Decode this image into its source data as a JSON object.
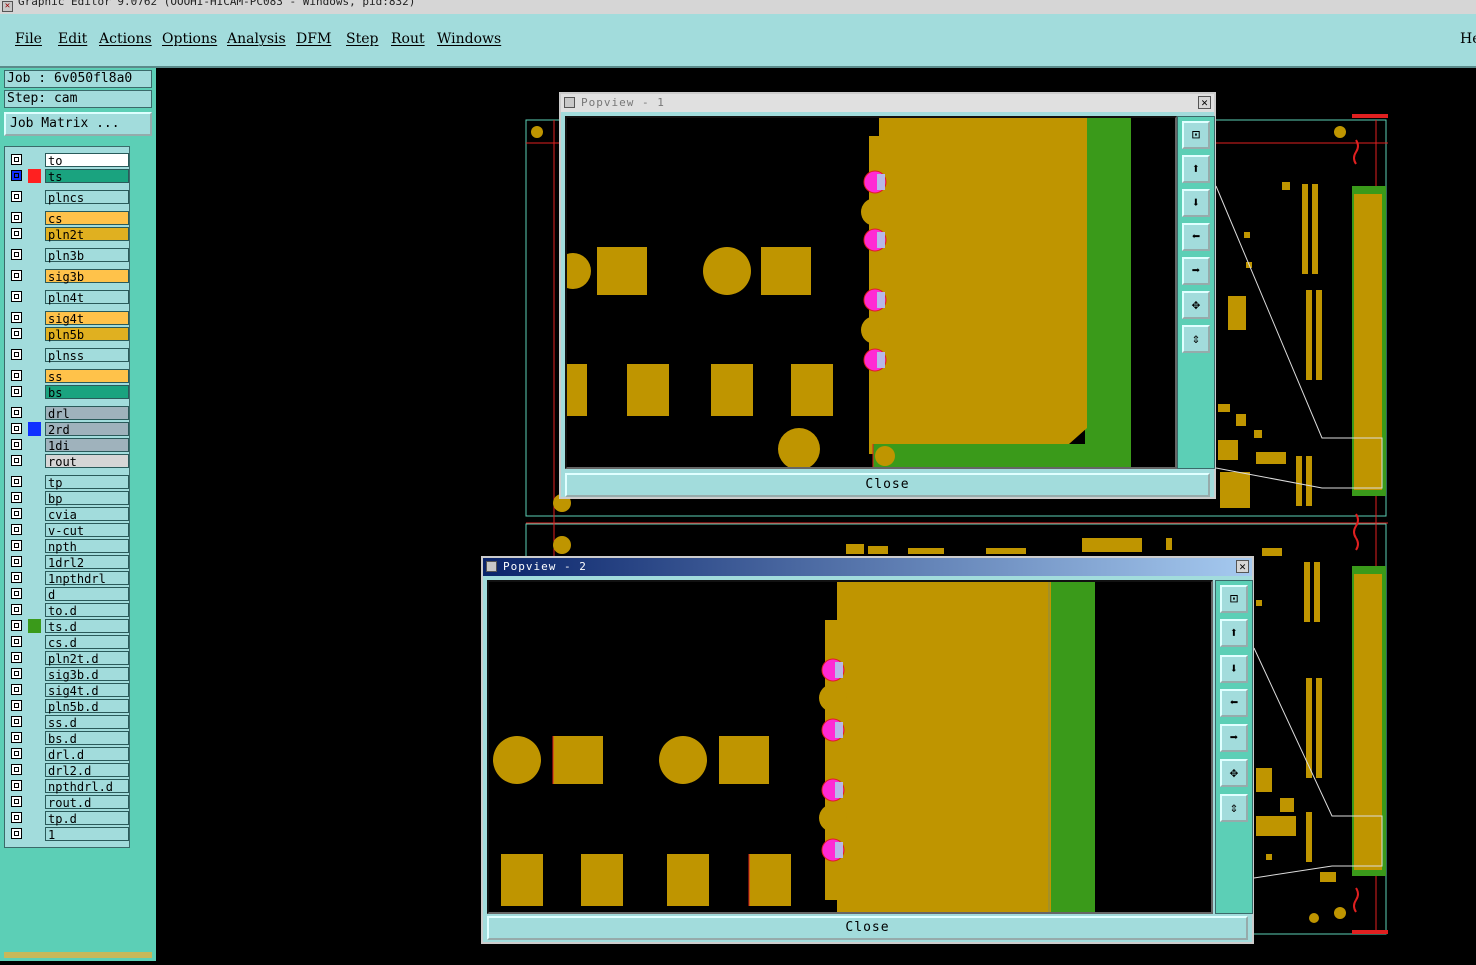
{
  "window": {
    "title": "Graphic Editor 9.0762 (OOOHI-HICAM-PC083 - Windows, pid:832)"
  },
  "menu": {
    "items": [
      "File",
      "Edit",
      "Actions",
      "Options",
      "Analysis",
      "DFM",
      "Step",
      "Rout",
      "Windows"
    ],
    "help": "He"
  },
  "job": {
    "label": "Job : 6v050fl8a0",
    "step": "Step: cam",
    "matrix_button": "Job Matrix ..."
  },
  "layers": [
    {
      "name": "to",
      "color": "#ffffff",
      "swatch": "",
      "active": true
    },
    {
      "name": "ts",
      "color": "#1aa37f",
      "swatch": "#ff2020",
      "active": true
    },
    {
      "name": "plncs",
      "color": "#a2dcdc",
      "swatch": ""
    },
    {
      "name": "cs",
      "color": "#ffc24a",
      "swatch": ""
    },
    {
      "name": "pln2t",
      "color": "#e0b020",
      "swatch": ""
    },
    {
      "name": "pln3b",
      "color": "#a2dcdc",
      "swatch": ""
    },
    {
      "name": "sig3b",
      "color": "#ffc24a",
      "swatch": ""
    },
    {
      "name": "pln4t",
      "color": "#a2dcdc",
      "swatch": ""
    },
    {
      "name": "sig4t",
      "color": "#ffc24a",
      "swatch": ""
    },
    {
      "name": "pln5b",
      "color": "#e0b020",
      "swatch": ""
    },
    {
      "name": "plnss",
      "color": "#a2dcdc",
      "swatch": ""
    },
    {
      "name": "ss",
      "color": "#ffc24a",
      "swatch": ""
    },
    {
      "name": "bs",
      "color": "#1aa37f",
      "swatch": ""
    },
    {
      "name": "drl",
      "color": "#9fb2bc",
      "swatch": ""
    },
    {
      "name": "2rd",
      "color": "#9fb2bc",
      "swatch": "#1030ff"
    },
    {
      "name": "1di",
      "color": "#9fb2bc",
      "swatch": ""
    },
    {
      "name": "rout",
      "color": "#d6d6d6",
      "swatch": ""
    },
    {
      "name": "tp",
      "color": "#a2dcdc",
      "swatch": ""
    },
    {
      "name": "bp",
      "color": "#a2dcdc",
      "swatch": ""
    },
    {
      "name": "cvia",
      "color": "#a2dcdc",
      "swatch": ""
    },
    {
      "name": "v-cut",
      "color": "#a2dcdc",
      "swatch": ""
    },
    {
      "name": "npth",
      "color": "#a2dcdc",
      "swatch": ""
    },
    {
      "name": "1drl2",
      "color": "#a2dcdc",
      "swatch": ""
    },
    {
      "name": "1npthdrl",
      "color": "#a2dcdc",
      "swatch": ""
    },
    {
      "name": "d",
      "color": "#a2dcdc",
      "swatch": ""
    },
    {
      "name": "to.d",
      "color": "#a2dcdc",
      "swatch": ""
    },
    {
      "name": "ts.d",
      "color": "#a2dcdc",
      "swatch": "#3a9a1a"
    },
    {
      "name": "cs.d",
      "color": "#a2dcdc",
      "swatch": ""
    },
    {
      "name": "pln2t.d",
      "color": "#a2dcdc",
      "swatch": ""
    },
    {
      "name": "sig3b.d",
      "color": "#a2dcdc",
      "swatch": ""
    },
    {
      "name": "sig4t.d",
      "color": "#a2dcdc",
      "swatch": ""
    },
    {
      "name": "pln5b.d",
      "color": "#a2dcdc",
      "swatch": ""
    },
    {
      "name": "ss.d",
      "color": "#a2dcdc",
      "swatch": ""
    },
    {
      "name": "bs.d",
      "color": "#a2dcdc",
      "swatch": ""
    },
    {
      "name": "drl.d",
      "color": "#a2dcdc",
      "swatch": ""
    },
    {
      "name": "drl2.d",
      "color": "#a2dcdc",
      "swatch": ""
    },
    {
      "name": "npthdrl.d",
      "color": "#a2dcdc",
      "swatch": ""
    },
    {
      "name": "rout.d",
      "color": "#a2dcdc",
      "swatch": ""
    },
    {
      "name": "tp.d",
      "color": "#a2dcdc",
      "swatch": ""
    },
    {
      "name": "1",
      "color": "#a2dcdc",
      "swatch": ""
    }
  ],
  "popups": [
    {
      "title": "Popview - 1",
      "close_label": "Close",
      "close_x": "✕"
    },
    {
      "title": "Popview - 2",
      "close_label": "Close",
      "close_x": "✕"
    }
  ],
  "tool_icons": [
    "zoom-home-icon",
    "pan-up-icon",
    "pan-down-icon",
    "pan-left-icon",
    "pan-right-icon",
    "zoom-in-icon",
    "zoom-out-icon"
  ],
  "colors": {
    "menubar": "#a2dcdc",
    "panel": "#5ccfb6",
    "copper": "#bf9500",
    "ts": "#3a9a1a",
    "pad_hole": "#ff2ad4",
    "outline": "#e02020"
  }
}
